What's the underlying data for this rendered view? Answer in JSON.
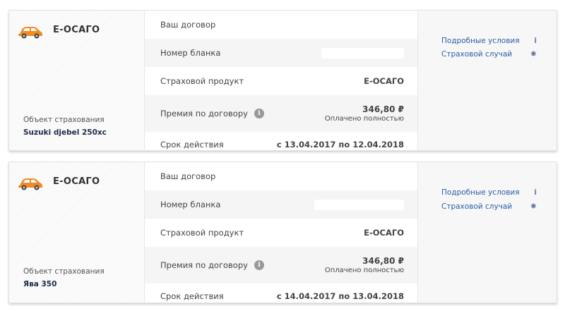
{
  "policies": [
    {
      "product": "Е-ОСАГО",
      "object_label": "Объект страхования",
      "object_value": "Suzuki djebel 250xc",
      "rows": {
        "contract_label": "Ваш договор",
        "blank_label": "Номер бланка",
        "product_label": "Страховой продукт",
        "product_value": "Е-ОСАГО",
        "premium_label": "Премия по договору",
        "premium_amount": "346,80 ₽",
        "premium_status": "Оплачено полностью",
        "term_label": "Срок действия",
        "term_value": "с 13.04.2017 по 12.04.2018"
      },
      "links": {
        "details": "Подробные условия",
        "claim": "Страховой случай"
      }
    },
    {
      "product": "Е-ОСАГО",
      "object_label": "Объект страхования",
      "object_value": "Ява 350",
      "rows": {
        "contract_label": "Ваш договор",
        "blank_label": "Номер бланка",
        "product_label": "Страховой продукт",
        "product_value": "Е-ОСАГО",
        "premium_label": "Премия по договору",
        "premium_amount": "346,80 ₽",
        "premium_status": "Оплачено полностью",
        "term_label": "Срок действия",
        "term_value": "с 14.04.2017 по 13.04.2018"
      },
      "links": {
        "details": "Подробные условия",
        "claim": "Страховой случай"
      }
    }
  ],
  "icons": {
    "car": "car-icon",
    "info": "info-icon",
    "details": "info-small-icon",
    "claim": "flame-icon"
  },
  "colors": {
    "accent_orange": "#f08a24",
    "link_blue": "#2b5ea6"
  }
}
